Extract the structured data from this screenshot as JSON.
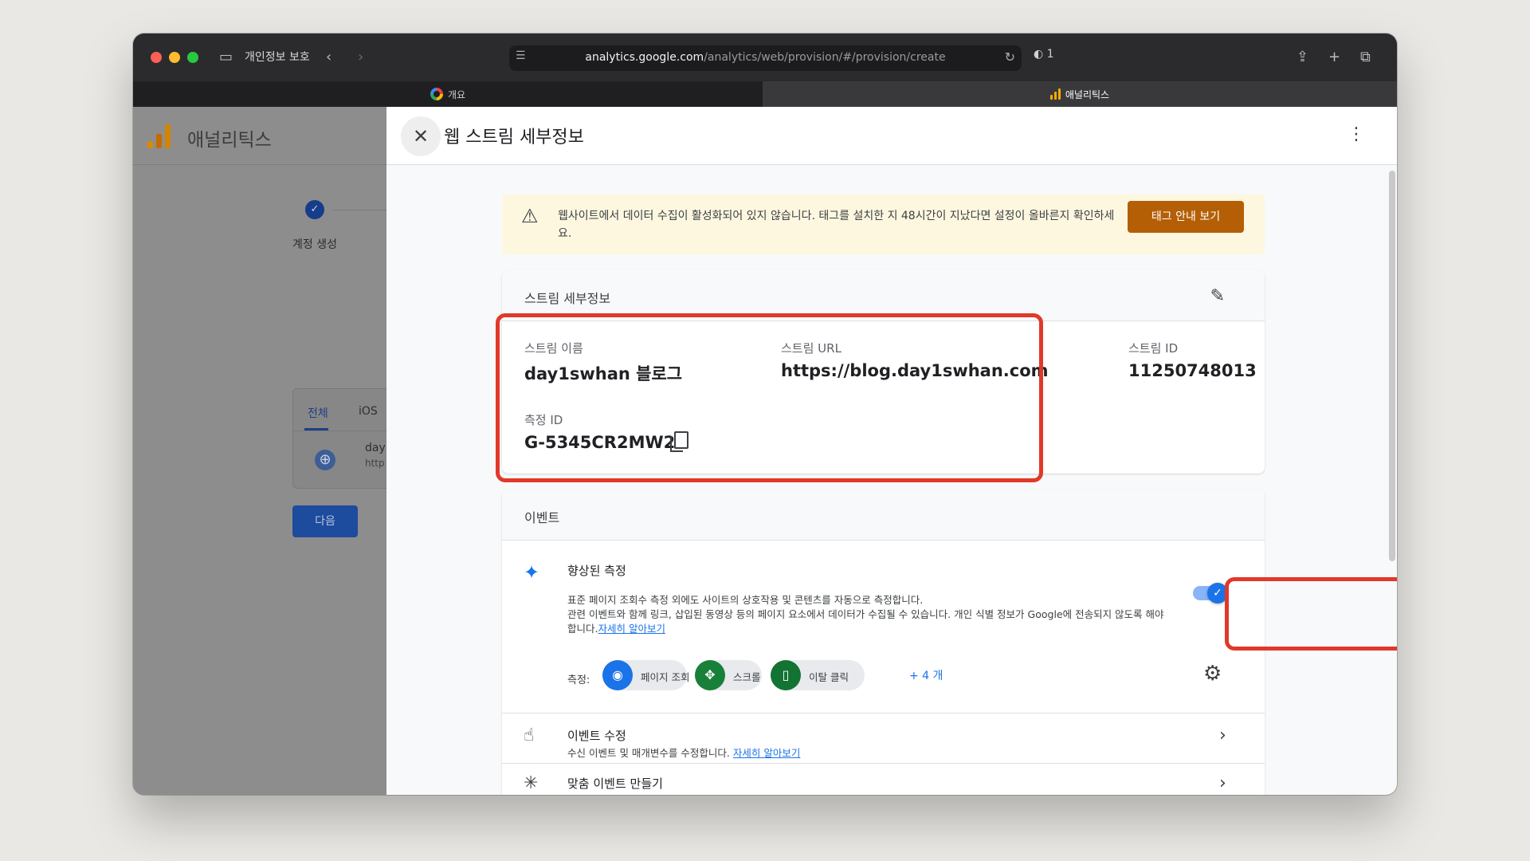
{
  "browser": {
    "privacy_label": "개인정보 보호",
    "url_host": "analytics.google.com",
    "url_path": "/analytics/web/provision/#/provision/create",
    "shield_count": "1",
    "tabs": [
      {
        "label": "개요"
      },
      {
        "label": "애널리틱스"
      }
    ]
  },
  "left": {
    "app_title": "애널리틱스",
    "step_label": "계정 생성",
    "stream_tabs": [
      "전체",
      "iOS"
    ],
    "stream_item_name": "day",
    "stream_item_url": "http",
    "next_button": "다음"
  },
  "panel": {
    "title": "웹 스트림 세부정보",
    "alert": {
      "text": "웹사이트에서 데이터 수집이 활성화되어 있지 않습니다. 태그를 설치한 지 48시간이 지났다면 설정이 올바른지 확인하세요.",
      "button": "태그 안내 보기"
    },
    "details": {
      "title": "스트림 세부정보",
      "name_label": "스트림 이름",
      "name_value": "day1swhan 블로그",
      "url_label": "스트림 URL",
      "url_value": "https://blog.day1swhan.com",
      "id_label": "스트림 ID",
      "id_value": "11250748013",
      "measurement_label": "측정 ID",
      "measurement_value": "G-5345CR2MW2"
    },
    "events": {
      "title": "이벤트",
      "enhanced_title": "향상된 측정",
      "enhanced_desc_1": "표준 페이지 조회수 측정 외에도 사이트의 상호작용 및 콘텐츠를 자동으로 측정합니다.",
      "enhanced_desc_2": "관련 이벤트와 함께 링크, 삽입된 동영상 등의 페이지 요소에서 데이터가 수집될 수 있습니다. 개인 식별 정보가 Google에 전송되지 않도록 해야",
      "enhanced_desc_3": "합니다.",
      "learn_more": "자세히 알아보기",
      "toggle_on": true,
      "measure_label": "측정:",
      "chips": [
        {
          "label": "페이지 조회",
          "color": "#1a73e8"
        },
        {
          "label": "스크롤",
          "color": "#188038"
        },
        {
          "label": "이탈 클릭",
          "color": "#137333"
        }
      ],
      "more_chips": "+ 4 개",
      "modify_title": "이벤트 수정",
      "modify_desc": "수신 이벤트 및 매개변수를 수정합니다.",
      "custom_title": "맞춤 이벤트 만들기"
    }
  }
}
